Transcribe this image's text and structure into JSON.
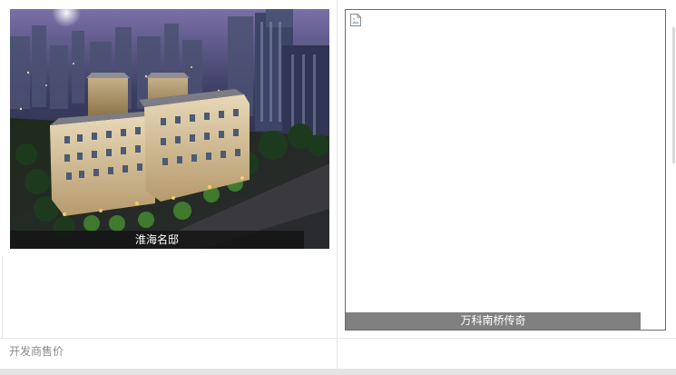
{
  "listings": [
    {
      "name": "淮海名邸",
      "image": "night rendering of residential buildings"
    },
    {
      "name": "万科南桥传奇",
      "image": "broken image"
    }
  ],
  "footer": {
    "developer_price_label": "开发商售价"
  },
  "icons": {
    "broken_image": "broken-image-icon"
  }
}
